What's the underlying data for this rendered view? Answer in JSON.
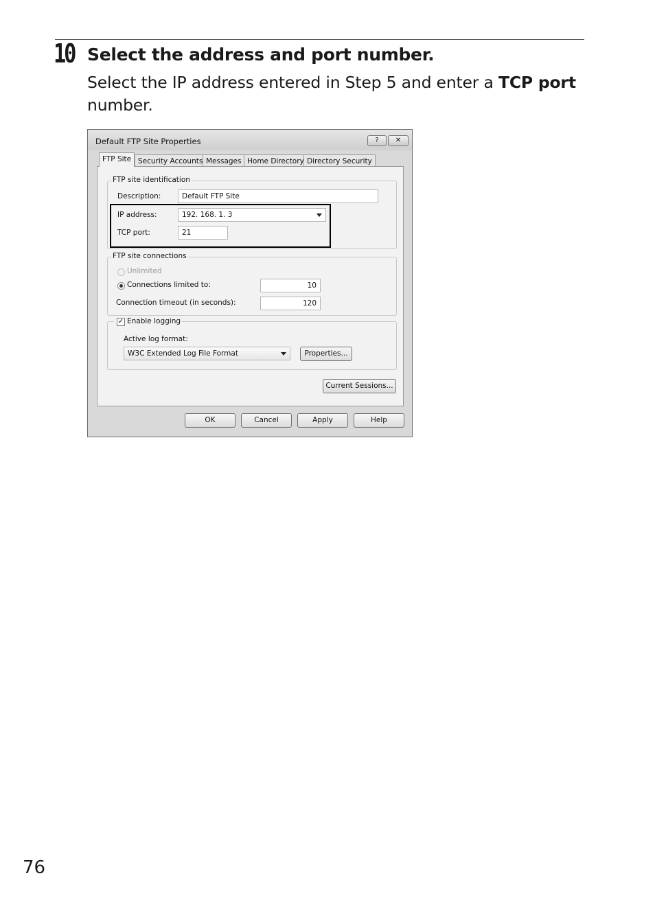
{
  "step": {
    "number": "10",
    "title": "Select the address and port number.",
    "body_before": "Select the IP address entered in Step 5 and enter a ",
    "body_bold": "TCP port",
    "body_after": " number."
  },
  "dialog": {
    "title": "Default FTP Site Properties",
    "help_button": "?",
    "close_button": "✕",
    "tabs": [
      "FTP Site",
      "Security Accounts",
      "Messages",
      "Home Directory",
      "Directory Security"
    ],
    "identification": {
      "group_label": "FTP site identification",
      "description_label": "Description:",
      "description_value": "Default FTP Site",
      "ip_label": "IP address:",
      "ip_value": "192. 168. 1. 3",
      "tcp_label": "TCP port:",
      "tcp_value": "21"
    },
    "connections": {
      "group_label": "FTP site connections",
      "unlimited_label": "Unlimited",
      "limited_label": "Connections limited to:",
      "limited_value": "10",
      "timeout_label": "Connection timeout (in seconds):",
      "timeout_value": "120"
    },
    "logging": {
      "enable_label": "Enable logging",
      "enabled": true,
      "format_label": "Active log format:",
      "format_value": "W3C Extended Log File Format",
      "properties_button": "Properties..."
    },
    "current_sessions_button": "Current Sessions...",
    "buttons": {
      "ok": "OK",
      "cancel": "Cancel",
      "apply": "Apply",
      "help": "Help"
    }
  },
  "page_number": "76"
}
